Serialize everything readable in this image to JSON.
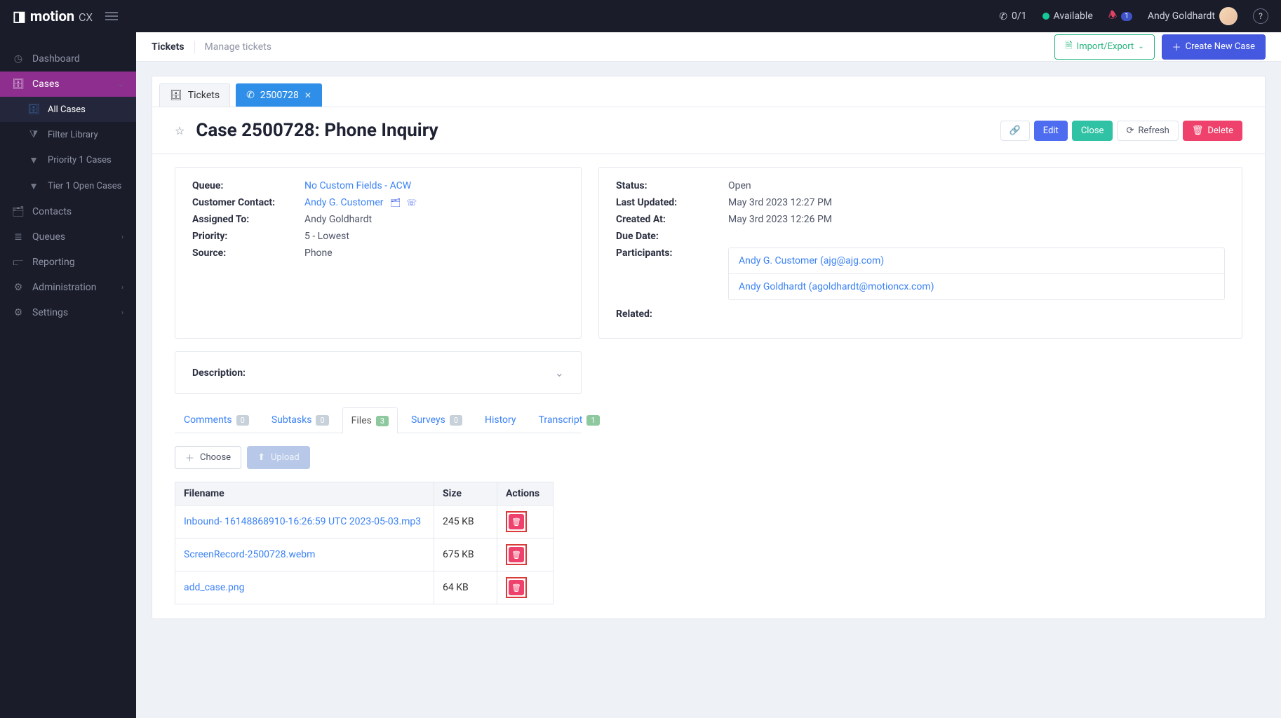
{
  "brand": {
    "name": "motion",
    "suffix": "cx"
  },
  "topbar": {
    "call_ratio": "0/1",
    "status": "Available",
    "notification_count": "1",
    "username": "Andy Goldhardt"
  },
  "sidebar": {
    "items": [
      {
        "label": "Dashboard",
        "icon": "gauge-icon"
      },
      {
        "label": "Cases",
        "icon": "briefcase-icon",
        "active": true,
        "children": [
          {
            "label": "All Cases",
            "highlight": true
          },
          {
            "label": "Filter Library"
          },
          {
            "label": "Priority 1 Cases"
          },
          {
            "label": "Tier 1 Open Cases"
          }
        ]
      },
      {
        "label": "Contacts",
        "icon": "address-book-icon"
      },
      {
        "label": "Queues",
        "icon": "layers-icon",
        "caret": true
      },
      {
        "label": "Reporting",
        "icon": "chart-icon"
      },
      {
        "label": "Administration",
        "icon": "user-cog-icon",
        "caret": true
      },
      {
        "label": "Settings",
        "icon": "gear-icon",
        "caret": true
      }
    ]
  },
  "breadcrumb": {
    "primary": "Tickets",
    "secondary": "Manage tickets"
  },
  "header_actions": {
    "import_export": "Import/Export",
    "create_case": "Create New Case"
  },
  "tabs": {
    "tickets": "Tickets",
    "case_number": "2500728"
  },
  "case": {
    "title": "Case 2500728: Phone Inquiry",
    "actions": {
      "edit": "Edit",
      "close": "Close",
      "refresh": "Refresh",
      "delete": "Delete"
    },
    "left": {
      "queue_label": "Queue:",
      "queue_value": "No Custom Fields - ACW",
      "contact_label": "Customer Contact:",
      "contact_value": "Andy G. Customer",
      "assigned_label": "Assigned To:",
      "assigned_value": "Andy Goldhardt",
      "priority_label": "Priority:",
      "priority_value": "5 - Lowest",
      "source_label": "Source:",
      "source_value": "Phone"
    },
    "right": {
      "status_label": "Status:",
      "status_value": "Open",
      "updated_label": "Last Updated:",
      "updated_value": "May 3rd 2023 12:27 PM",
      "created_label": "Created At:",
      "created_value": "May 3rd 2023 12:26 PM",
      "due_label": "Due Date:",
      "due_value": "",
      "participants_label": "Participants:",
      "participants": [
        "Andy G. Customer (ajg@ajg.com)",
        "Andy Goldhardt (agoldhardt@motioncx.com)"
      ],
      "related_label": "Related:"
    },
    "description_label": "Description:"
  },
  "subtabs": {
    "comments": {
      "label": "Comments",
      "count": "0"
    },
    "subtasks": {
      "label": "Subtasks",
      "count": "0"
    },
    "files": {
      "label": "Files",
      "count": "3"
    },
    "surveys": {
      "label": "Surveys",
      "count": "0"
    },
    "history": {
      "label": "History"
    },
    "transcript": {
      "label": "Transcript",
      "count": "1"
    }
  },
  "file_area": {
    "choose": "Choose",
    "upload": "Upload",
    "headers": {
      "filename": "Filename",
      "size": "Size",
      "actions": "Actions"
    },
    "rows": [
      {
        "name": "Inbound- 16148868910-16:26:59 UTC 2023-05-03.mp3",
        "size": "245 KB"
      },
      {
        "name": "ScreenRecord-2500728.webm",
        "size": "675 KB"
      },
      {
        "name": "add_case.png",
        "size": "64 KB"
      }
    ]
  }
}
